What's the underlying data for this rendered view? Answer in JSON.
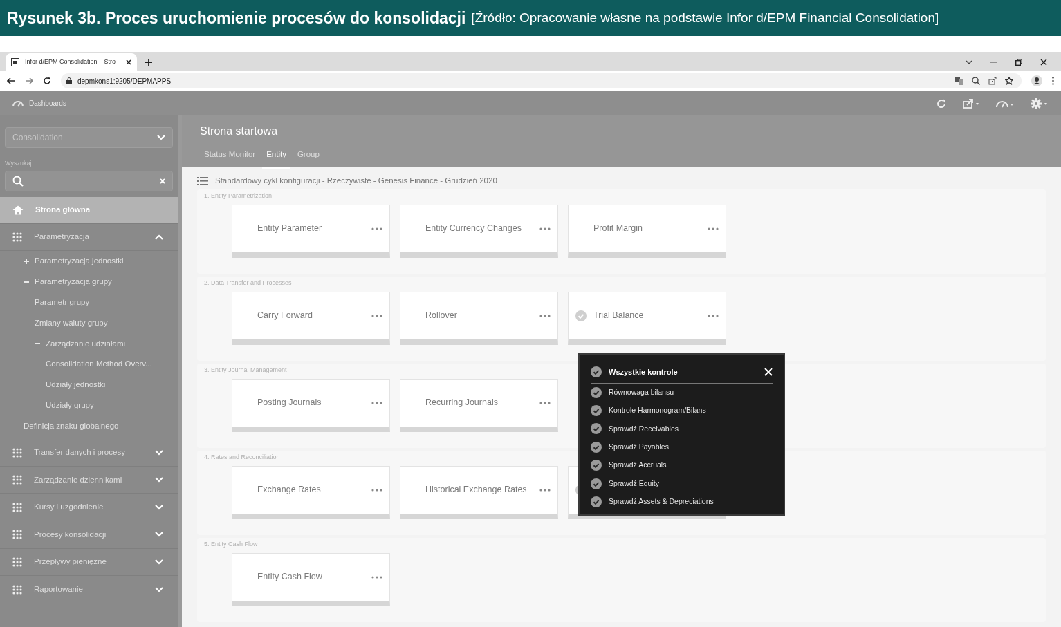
{
  "caption": {
    "title": "Rysunek 3b. Proces uruchomienie procesów do konsolidacji",
    "source": "[Źródło: Opracowanie własne na podstawie Infor d/EPM Financial Consolidation]"
  },
  "browser": {
    "tab_title": "Infor d/EPM Consolidation – Stro",
    "address": "depmkons1:9205/DEPMAPPS"
  },
  "app_header": {
    "title": "Dashboards"
  },
  "sidebar": {
    "dropdown": "Consolidation",
    "search_label": "Wyszukaj",
    "items": [
      {
        "kind": "home",
        "label": "Strona główna",
        "selected": true
      },
      {
        "kind": "group",
        "label": "Parametryzacja",
        "selected": false,
        "expanded": true,
        "children": [
          {
            "label": "Parametryzacja jednostki",
            "expanded": false
          },
          {
            "label": "Parametryzacja grupy",
            "expanded": true,
            "children": [
              {
                "label": "Parametr grupy"
              },
              {
                "label": "Zmiany waluty grupy"
              },
              {
                "label": "Zarządzanie udziałami",
                "expanded": true,
                "children": [
                  {
                    "label": "Consolidation Method Overv..."
                  },
                  {
                    "label": "Udziały jednostki"
                  },
                  {
                    "label": "Udziały grupy"
                  }
                ]
              }
            ]
          },
          {
            "label": "Definicja znaku globalnego"
          }
        ]
      },
      {
        "kind": "group",
        "label": "Transfer danych i procesy",
        "selected": false,
        "expanded": false
      },
      {
        "kind": "group",
        "label": "Zarządzanie dziennikami",
        "selected": false,
        "expanded": false
      },
      {
        "kind": "group",
        "label": "Kursy i uzgodnienie",
        "selected": false,
        "expanded": false
      },
      {
        "kind": "group",
        "label": "Procesy konsolidacji",
        "selected": false,
        "expanded": false
      },
      {
        "kind": "group",
        "label": "Przepływy pieniężne",
        "selected": false,
        "expanded": false
      },
      {
        "kind": "group",
        "label": "Raportowanie",
        "selected": false,
        "expanded": false
      }
    ]
  },
  "main": {
    "title": "Strona startowa",
    "tabs": [
      {
        "label": "Status Monitor",
        "selected": false
      },
      {
        "label": "Entity",
        "selected": true
      },
      {
        "label": "Group",
        "selected": false
      }
    ],
    "breadcrumb": "Standardowy cykl konfiguracji - Rzeczywiste - Genesis Finance - Grudzień 2020",
    "sections": [
      {
        "title": "1. Entity Parametrization",
        "tiles": [
          {
            "label": "Entity Parameter",
            "checked": false
          },
          {
            "label": "Entity Currency Changes",
            "checked": false
          },
          {
            "label": "Profit Margin",
            "checked": false
          }
        ]
      },
      {
        "title": "2. Data Transfer and Processes",
        "tiles": [
          {
            "label": "Carry Forward",
            "checked": false
          },
          {
            "label": "Rollover",
            "checked": false
          },
          {
            "label": "Trial Balance",
            "checked": true
          }
        ]
      },
      {
        "title": "3. Entity Journal Management",
        "tiles": [
          {
            "label": "Posting Journals",
            "checked": false
          },
          {
            "label": "Recurring Journals",
            "checked": false
          }
        ]
      },
      {
        "title": "4. Rates and Reconciliation",
        "tiles": [
          {
            "label": "Exchange Rates",
            "checked": false
          },
          {
            "label": "Historical Exchange Rates",
            "checked": false
          },
          {
            "checked": true
          }
        ]
      },
      {
        "title": "5. Entity Cash Flow",
        "tiles": [
          {
            "label": "Entity Cash Flow",
            "checked": false
          }
        ]
      }
    ]
  },
  "popup": {
    "title": "Wszystkie kontrole",
    "items": [
      "Równowaga bilansu",
      "Kontrole Harmonogram/Bilans",
      "Sprawdź Receivables",
      "Sprawdź Payables",
      "Sprawdź Accruals",
      "Sprawdź Equity",
      "Sprawdź Assets & Depreciations"
    ]
  }
}
